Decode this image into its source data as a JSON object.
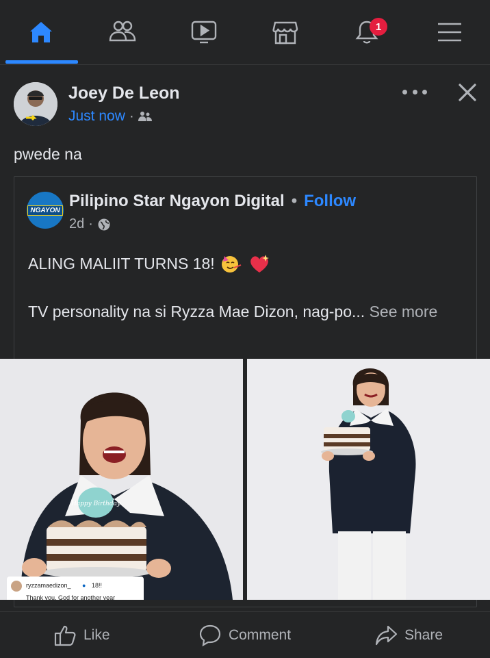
{
  "nav": {
    "items": [
      {
        "name": "home",
        "icon": "home-icon"
      },
      {
        "name": "friends",
        "icon": "friends-icon"
      },
      {
        "name": "watch",
        "icon": "video-icon"
      },
      {
        "name": "marketplace",
        "icon": "marketplace-icon"
      },
      {
        "name": "notifications",
        "icon": "bell-icon"
      },
      {
        "name": "menu",
        "icon": "hamburger-icon"
      }
    ],
    "notification_count": "1",
    "accent": "#2d88ff"
  },
  "post": {
    "author": "Joey De Leon",
    "time": "Just now",
    "audience_icon": "friends-audience-icon",
    "text": "pwede na"
  },
  "shared": {
    "page_name": "Pilipino Star Ngayon Digital",
    "follow_label": "Follow",
    "time": "2d",
    "privacy_icon": "globe-icon",
    "logo_text": "NGAYON",
    "headline": "ALING MALIIT TURNS 18!",
    "body": "TV personality na si Ryzza Mae Dizon, nag-po...",
    "see_more": "See more"
  },
  "photos": {
    "ig_username": "ryzzamaedizon_",
    "ig_caption_extra": "18!!",
    "ig_comment": "Thank you, God for another year",
    "cake_topper": "Happy Birthday"
  },
  "actions": {
    "like": "Like",
    "comment": "Comment",
    "share": "Share"
  }
}
